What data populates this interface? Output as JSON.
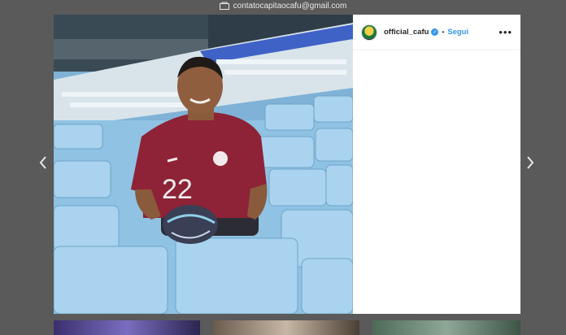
{
  "header": {
    "email": "contatocapitaocafu@gmail.com",
    "email_icon": "mail-icon"
  },
  "post": {
    "image_description": "Man in maroon number 22 jersey sitting in light blue stadium seats holding a football",
    "jersey_number": "22"
  },
  "sidebar": {
    "username": "official_cafu",
    "verified_icon": "verified-badge-icon",
    "separator": "•",
    "follow_label": "Segui",
    "more_label": "•••"
  },
  "navigation": {
    "prev_icon": "chevron-left-icon",
    "next_icon": "chevron-right-icon"
  },
  "colors": {
    "background": "#5a5a5a",
    "follow": "#3897f0",
    "verified": "#3897f0",
    "seat_blue": "#8cc3e6",
    "jersey": "#8e2236"
  }
}
